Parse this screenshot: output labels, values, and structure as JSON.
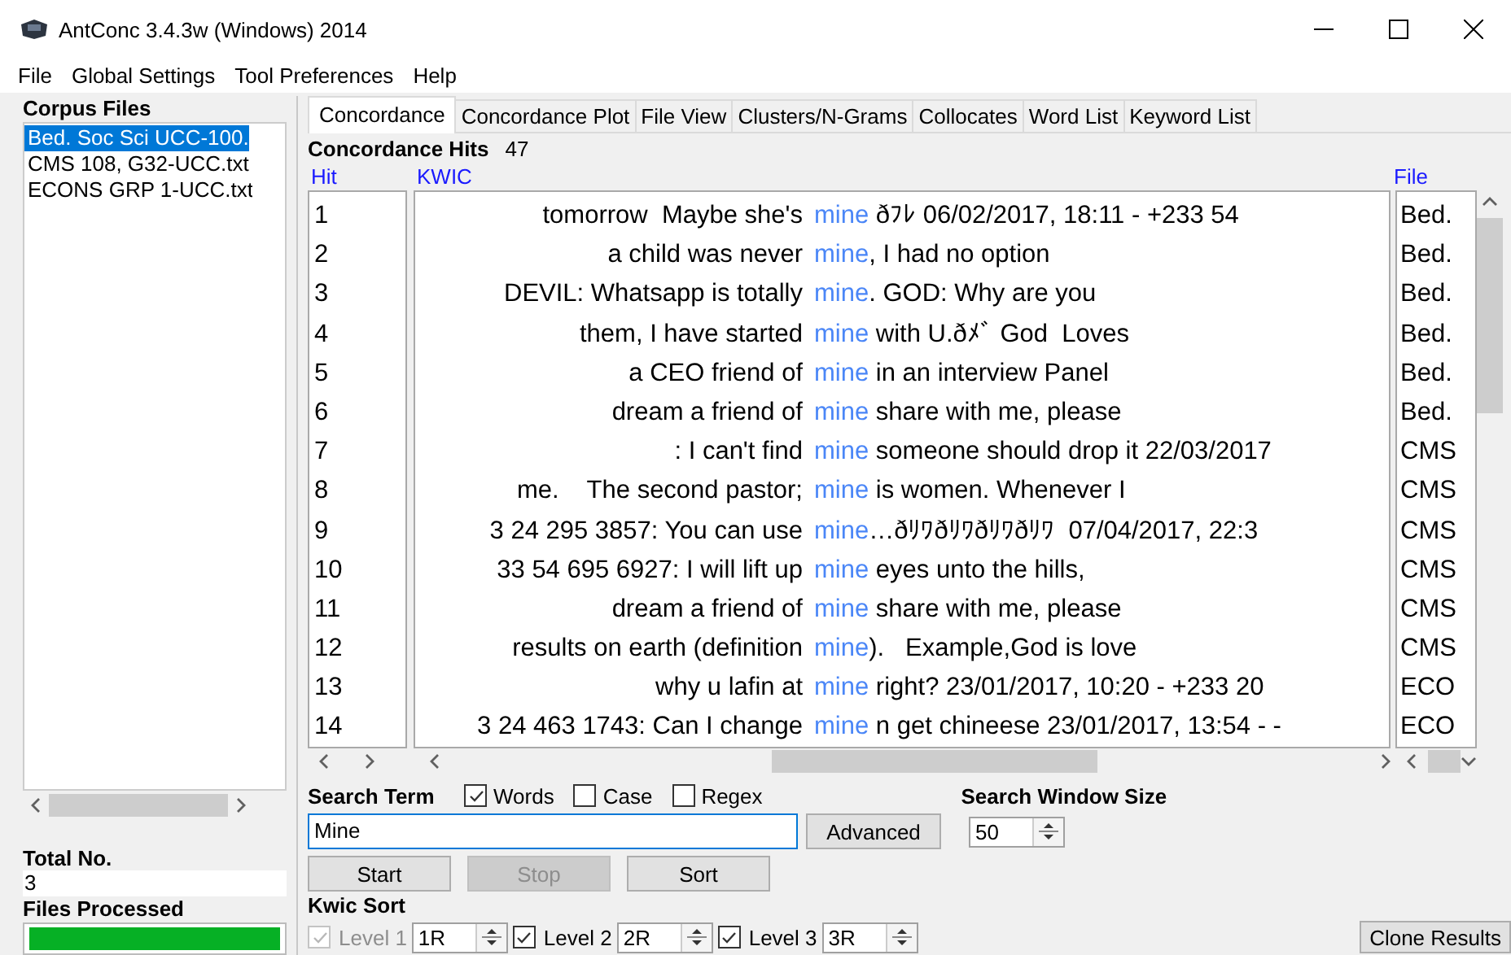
{
  "window": {
    "title": "AntConc 3.4.3w (Windows) 2014"
  },
  "menu": [
    "File",
    "Global Settings",
    "Tool Preferences",
    "Help"
  ],
  "corpus_files": {
    "label": "Corpus Files",
    "items": [
      {
        "name": "Bed. Soc Sci UCC-100.",
        "selected": true
      },
      {
        "name": "CMS 108, G32-UCC.txt",
        "selected": false
      },
      {
        "name": "ECONS GRP 1-UCC.txt",
        "selected": false
      }
    ]
  },
  "total": {
    "label": "Total No.",
    "value": "3"
  },
  "files_processed": {
    "label": "Files Processed",
    "level": 1
  },
  "tabs": [
    {
      "label": "Concordance",
      "selected": true
    },
    {
      "label": "Concordance Plot",
      "selected": false
    },
    {
      "label": "File View",
      "selected": false
    },
    {
      "label": "Clusters/N-Grams",
      "selected": false
    },
    {
      "label": "Collocates",
      "selected": false
    },
    {
      "label": "Word List",
      "selected": false
    },
    {
      "label": "Keyword List",
      "selected": false
    }
  ],
  "hits": {
    "label": "Concordance Hits",
    "value": "47"
  },
  "table": {
    "columns": [
      "Hit",
      "KWIC",
      "File"
    ],
    "rows": [
      {
        "hit": "1",
        "left": "tomorrow  Maybe she's",
        "keyword": "mine",
        "right": " ðﾌﾚ 06/02/2017, 18:11 - +233 54",
        "file": "Bed."
      },
      {
        "hit": "2",
        "left": "a child was never",
        "keyword": "mine",
        "right": ", I had no option",
        "file": "Bed."
      },
      {
        "hit": "3",
        "left": "DEVIL: Whatsapp is totally",
        "keyword": "mine",
        "right": ". GOD: Why are you",
        "file": "Bed."
      },
      {
        "hit": "4",
        "left": "them, I have started",
        "keyword": "mine",
        "right": " with U.ðﾒﾞ God  Loves",
        "file": "Bed."
      },
      {
        "hit": "5",
        "left": "a CEO friend of",
        "keyword": "mine",
        "right": " in an interview Panel",
        "file": "Bed."
      },
      {
        "hit": "6",
        "left": "dream a friend of",
        "keyword": "mine",
        "right": " share with me, please",
        "file": "Bed."
      },
      {
        "hit": "7",
        "left": ": I can't find",
        "keyword": "mine",
        "right": " someone should drop it 22/03/2017",
        "file": "CMS"
      },
      {
        "hit": "8",
        "left": "me.    The second pastor;",
        "keyword": "mine",
        "right": " is women. Whenever I",
        "file": "CMS"
      },
      {
        "hit": "9",
        "left": "3 24 295 3857: You can use",
        "keyword": "mine",
        "right": "…ðﾘﾜðﾘﾜðﾘﾜðﾘﾜ  07/04/2017, 22:3",
        "file": "CMS"
      },
      {
        "hit": "10",
        "left": "33 54 695 6927: I will lift up",
        "keyword": "mine",
        "right": " eyes unto the hills,",
        "file": "CMS"
      },
      {
        "hit": "11",
        "left": "dream a friend of",
        "keyword": "mine",
        "right": " share with me, please",
        "file": "CMS"
      },
      {
        "hit": "12",
        "left": "results on earth (definition",
        "keyword": "mine",
        "right": ").   Example,God is love",
        "file": "CMS"
      },
      {
        "hit": "13",
        "left": "why u lafin at",
        "keyword": "mine",
        "right": " right? 23/01/2017, 10:20 - +233 20",
        "file": "ECO"
      },
      {
        "hit": "14",
        "left": "3 24 463 1743: Can I change",
        "keyword": "mine",
        "right": " n get chineese 23/01/2017, 13:54 - -",
        "file": "ECO"
      }
    ]
  },
  "search": {
    "label": "Search Term",
    "options": [
      {
        "label": "Words",
        "checked": true
      },
      {
        "label": "Case",
        "checked": false
      },
      {
        "label": "Regex",
        "checked": false
      }
    ],
    "value": "Mine",
    "advanced": "Advanced",
    "window_size_label": "Search Window Size",
    "window_size": "50"
  },
  "buttons": [
    {
      "label": "Start",
      "disabled": false
    },
    {
      "label": "Stop",
      "disabled": true
    },
    {
      "label": "Sort",
      "disabled": false
    }
  ],
  "kwic_sort": {
    "label": "Kwic Sort",
    "levels": [
      {
        "label": "Level 1",
        "checked": true,
        "disabled": true,
        "value": "1R"
      },
      {
        "label": "Level 2",
        "checked": true,
        "disabled": false,
        "value": "2R"
      },
      {
        "label": "Level 3",
        "checked": true,
        "disabled": false,
        "value": "3R"
      }
    ]
  },
  "clone_button": "Clone Results"
}
